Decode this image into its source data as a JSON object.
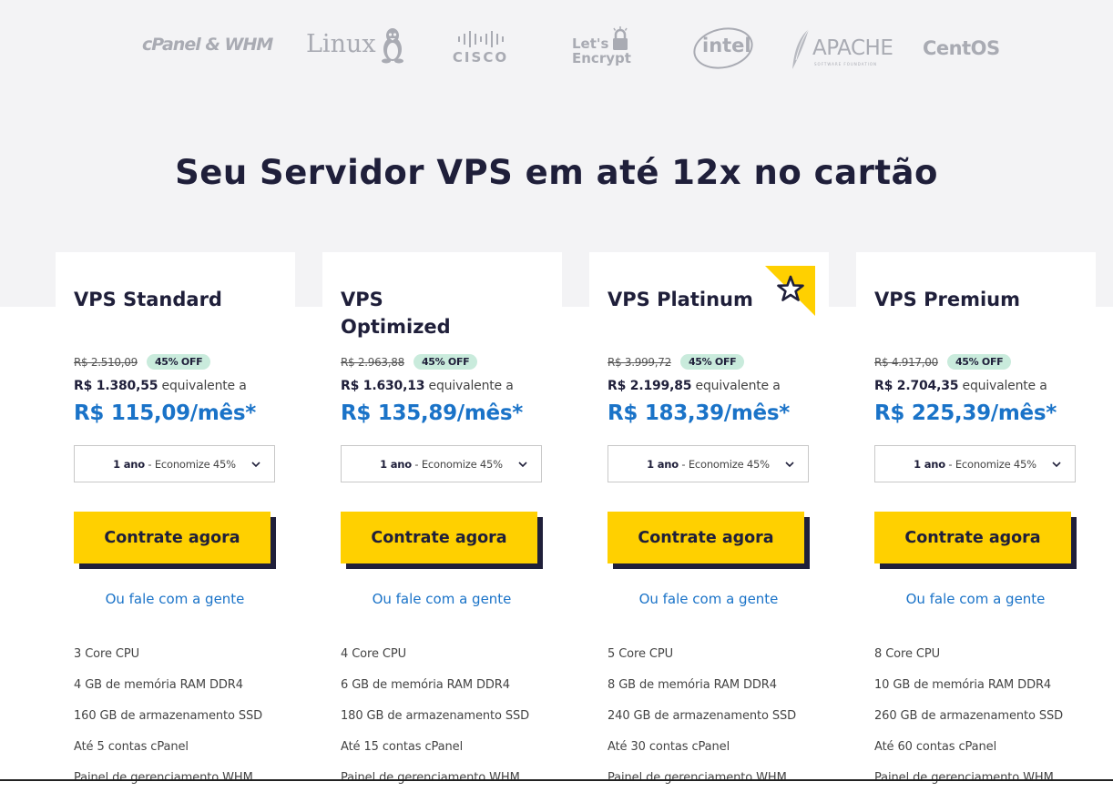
{
  "logos": {
    "cpanel": "cPanel & WHM",
    "linux": "Linux",
    "cisco": "CISCO",
    "letsencrypt_line1": "Let's",
    "letsencrypt_line2": "Encrypt",
    "intel": "intel",
    "apache": "APACHE",
    "apache_sub": "SOFTWARE FOUNDATION",
    "centos": "CentOS"
  },
  "headline": "Seu Servidor VPS em até 12x no cartão",
  "colors": {
    "accent_blue": "#1a73c8",
    "cta_yellow": "#ffd000",
    "navy": "#1f1f3a",
    "off_badge": "#c9ebdc"
  },
  "plans": [
    {
      "name": "VPS Standard",
      "old_price": "R$ 2.510,09",
      "discount": "45% OFF",
      "total": "R$ 1.380,55",
      "equiv_label": "equivalente a",
      "monthly": "R$ 115,09/mês*",
      "period_bold": "1 ano",
      "period_rest": " - Economize 45%",
      "cta": "Contrate agora",
      "contact": "Ou fale com a gente",
      "featured": false,
      "features": [
        "3 Core CPU",
        "4 GB de memória RAM DDR4",
        "160 GB de armazenamento SSD",
        "Até 5 contas cPanel",
        "Painel de gerenciamento WHM"
      ]
    },
    {
      "name": "VPS Optimized",
      "old_price": "R$ 2.963,88",
      "discount": "45% OFF",
      "total": "R$ 1.630,13",
      "equiv_label": "equivalente a",
      "monthly": "R$ 135,89/mês*",
      "period_bold": "1 ano",
      "period_rest": " - Economize 45%",
      "cta": "Contrate agora",
      "contact": "Ou fale com a gente",
      "featured": false,
      "features": [
        "4 Core CPU",
        "6 GB de memória RAM DDR4",
        "180 GB de armazenamento SSD",
        "Até 15 contas cPanel",
        "Painel de gerenciamento WHM"
      ]
    },
    {
      "name": "VPS Platinum",
      "old_price": "R$ 3.999,72",
      "discount": "45% OFF",
      "total": "R$ 2.199,85",
      "equiv_label": "equivalente a",
      "monthly": "R$ 183,39/mês*",
      "period_bold": "1 ano",
      "period_rest": " - Economize 45%",
      "cta": "Contrate agora",
      "contact": "Ou fale com a gente",
      "featured": true,
      "features": [
        "5 Core CPU",
        "8 GB de memória RAM DDR4",
        "240 GB de armazenamento SSD",
        "Até 30 contas cPanel",
        "Painel de gerenciamento WHM"
      ]
    },
    {
      "name": "VPS Premium",
      "old_price": "R$ 4.917,00",
      "discount": "45% OFF",
      "total": "R$ 2.704,35",
      "equiv_label": "equivalente a",
      "monthly": "R$ 225,39/mês*",
      "period_bold": "1 ano",
      "period_rest": " - Economize 45%",
      "cta": "Contrate agora",
      "contact": "Ou fale com a gente",
      "featured": false,
      "features": [
        "8 Core CPU",
        "10 GB de memória RAM DDR4",
        "260 GB de armazenamento SSD",
        "Até 60 contas cPanel",
        "Painel de gerenciamento WHM"
      ]
    }
  ]
}
